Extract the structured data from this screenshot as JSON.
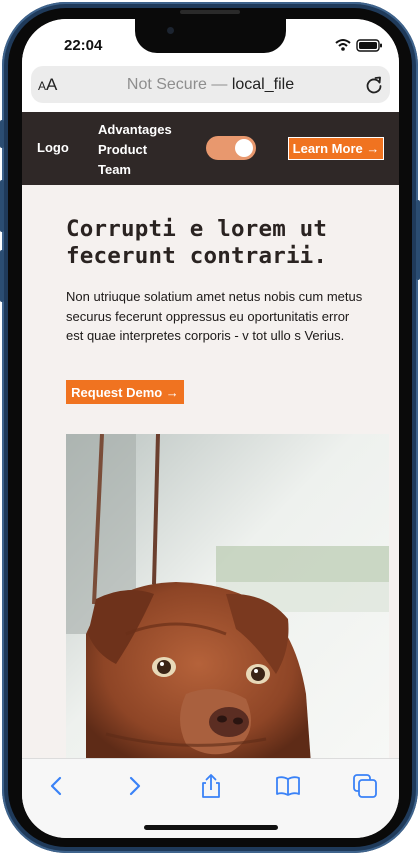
{
  "status_bar": {
    "time": "22:04"
  },
  "browser": {
    "text_size_label_small": "A",
    "text_size_label_large": "A",
    "security_label": "Not Secure — ",
    "url_host": "local_file",
    "icons": {
      "reload": "reload-icon",
      "back": "back-icon",
      "forward": "forward-icon",
      "share": "share-icon",
      "bookmarks": "bookmarks-icon",
      "tabs": "tabs-icon"
    }
  },
  "nav": {
    "logo": "Logo",
    "links": [
      "Advantages",
      "Product",
      "Team"
    ],
    "toggle_on": true,
    "cta": "Learn More →"
  },
  "hero": {
    "title": "Corrupti e lorem ut fecerunt contrarii.",
    "body": "Non utriuque solatium amet netus nobis cum metus securus fecerunt oppressus eu oportunitatis error est quae interpretes corporis - v tot ullo s Verius.",
    "button": "Request Demo →"
  },
  "colors": {
    "nav_background": "#2f2827",
    "accent": "#f07320",
    "toggle": "#e8986e",
    "page_background": "#f5f1ef"
  }
}
